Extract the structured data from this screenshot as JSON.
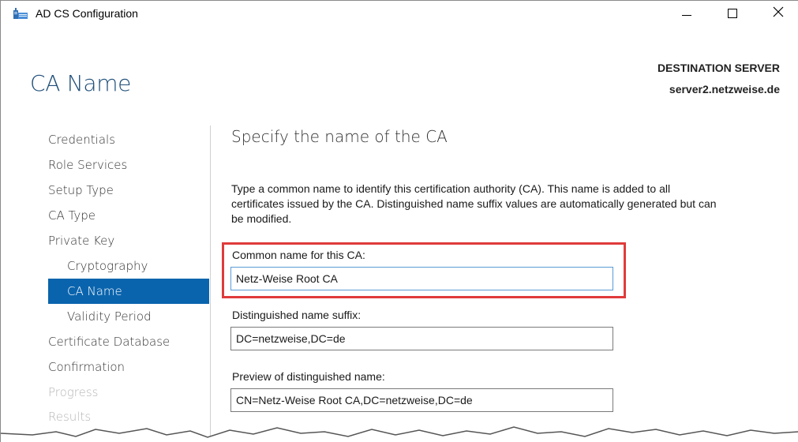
{
  "window": {
    "title": "AD CS Configuration",
    "icon": "server-role-icon",
    "controls": {
      "minimize": "minimize-icon",
      "maximize": "maximize-icon",
      "close": "✕"
    }
  },
  "page": {
    "title": "CA Name",
    "destination_label": "DESTINATION SERVER",
    "destination_server": "server2.netzweise.de"
  },
  "nav": {
    "items": [
      {
        "label": "Credentials",
        "state": "normal"
      },
      {
        "label": "Role Services",
        "state": "normal"
      },
      {
        "label": "Setup Type",
        "state": "normal"
      },
      {
        "label": "CA Type",
        "state": "normal"
      },
      {
        "label": "Private Key",
        "state": "normal"
      },
      {
        "label": "Cryptography",
        "state": "sub"
      },
      {
        "label": "CA Name",
        "state": "active"
      },
      {
        "label": "Validity Period",
        "state": "sub"
      },
      {
        "label": "Certificate Database",
        "state": "normal"
      },
      {
        "label": "Confirmation",
        "state": "normal"
      },
      {
        "label": "Progress",
        "state": "disabled"
      },
      {
        "label": "Results",
        "state": "disabled"
      }
    ]
  },
  "content": {
    "section_title": "Specify the name of the CA",
    "description_line1": "Type a common name to identify this certification authority (CA). This name is added to all",
    "description_line2": "certificates issued by the CA. Distinguished name suffix values are automatically generated but can",
    "description_line3": "be modified.",
    "common_name_label": "Common name for this CA:",
    "common_name_value": "Netz-Weise Root CA",
    "dn_suffix_label": "Distinguished name suffix:",
    "dn_suffix_value": "DC=netzweise,DC=de",
    "preview_label": "Preview of distinguished name:",
    "preview_value": "CN=Netz-Weise Root CA,DC=netzweise,DC=de"
  },
  "colors": {
    "accent": "#0a64ad",
    "title_blue": "#1f4e79",
    "highlight": "#e03b3b"
  }
}
